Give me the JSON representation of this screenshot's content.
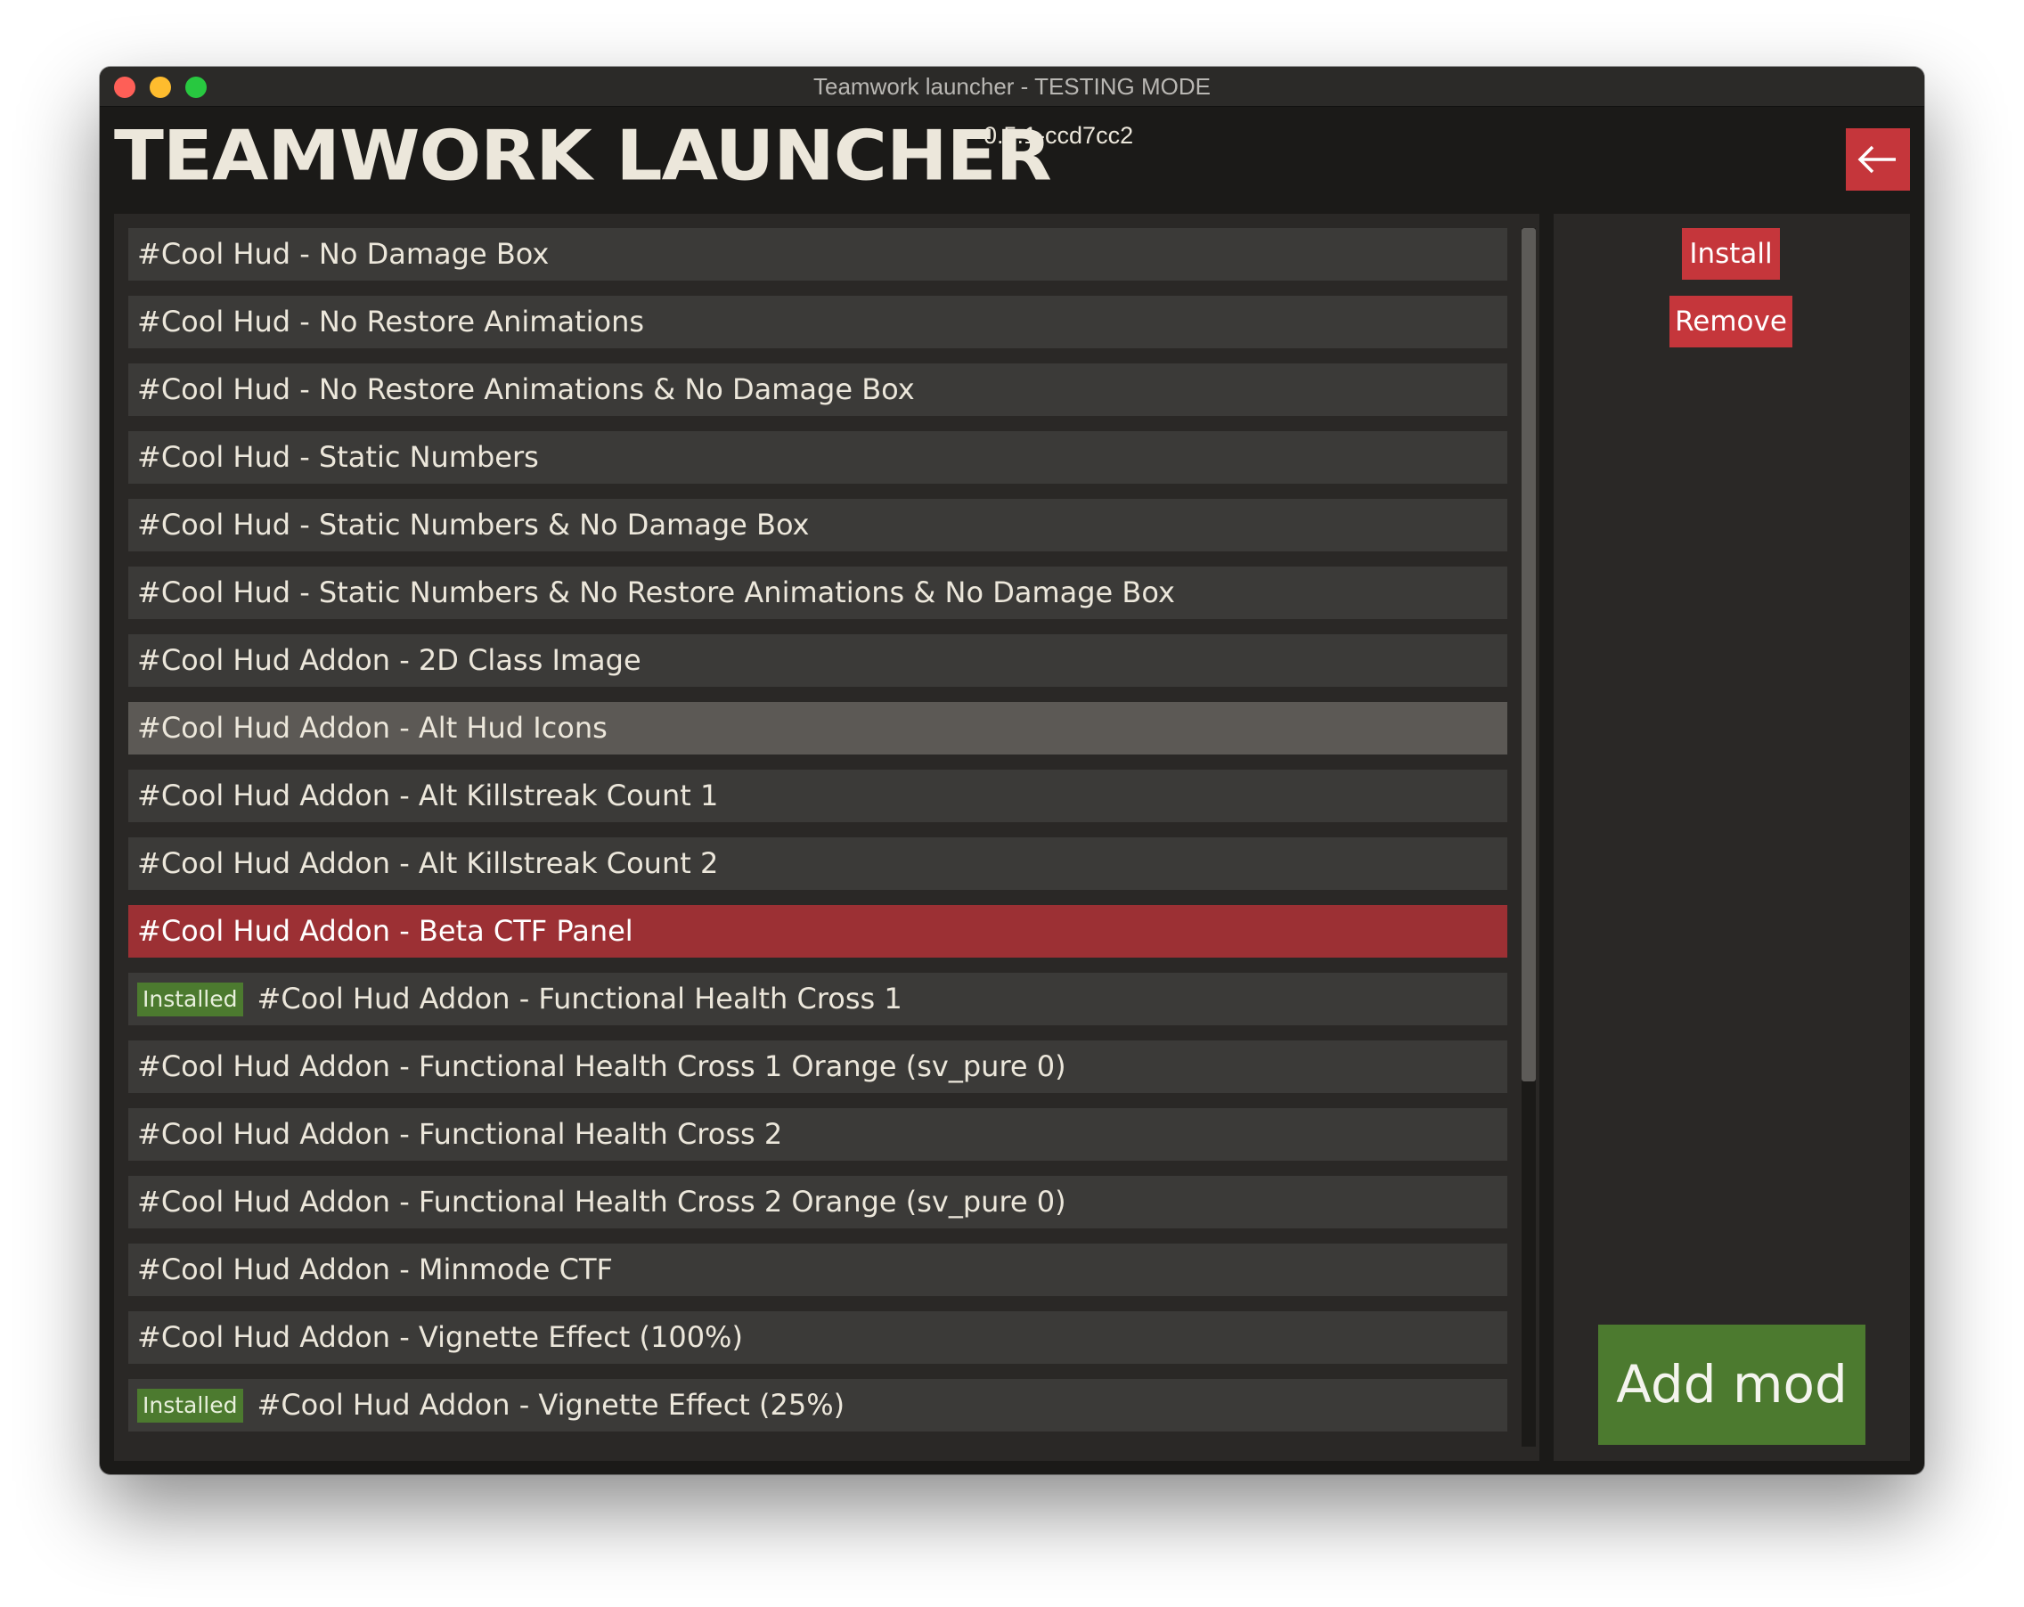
{
  "window": {
    "title": "Teamwork launcher - TESTING MODE"
  },
  "header": {
    "logo": "TEAMWORK LAUNCHER",
    "version": "0.5.1-ccd7cc2",
    "back_icon": "back-arrow-icon"
  },
  "mods": [
    {
      "name": "#Cool Hud - No Damage Box",
      "installed": false,
      "state": "normal"
    },
    {
      "name": "#Cool Hud - No Restore Animations",
      "installed": false,
      "state": "normal"
    },
    {
      "name": "#Cool Hud - No Restore Animations & No Damage Box",
      "installed": false,
      "state": "normal"
    },
    {
      "name": "#Cool Hud - Static Numbers",
      "installed": false,
      "state": "normal"
    },
    {
      "name": "#Cool Hud - Static Numbers & No Damage Box",
      "installed": false,
      "state": "normal"
    },
    {
      "name": "#Cool Hud - Static Numbers & No Restore Animations & No Damage Box",
      "installed": false,
      "state": "normal"
    },
    {
      "name": "#Cool Hud Addon - 2D Class Image",
      "installed": false,
      "state": "normal"
    },
    {
      "name": "#Cool Hud Addon - Alt Hud Icons",
      "installed": false,
      "state": "hovered"
    },
    {
      "name": "#Cool Hud Addon - Alt Killstreak Count 1",
      "installed": false,
      "state": "normal"
    },
    {
      "name": "#Cool Hud Addon - Alt Killstreak Count 2",
      "installed": false,
      "state": "normal"
    },
    {
      "name": "#Cool Hud Addon - Beta CTF Panel",
      "installed": false,
      "state": "selected"
    },
    {
      "name": "#Cool Hud Addon - Functional Health Cross 1",
      "installed": true,
      "state": "normal"
    },
    {
      "name": "#Cool Hud Addon - Functional Health Cross 1 Orange (sv_pure 0)",
      "installed": false,
      "state": "normal"
    },
    {
      "name": "#Cool Hud Addon - Functional Health Cross 2",
      "installed": false,
      "state": "normal"
    },
    {
      "name": "#Cool Hud Addon - Functional Health Cross 2 Orange (sv_pure 0)",
      "installed": false,
      "state": "normal"
    },
    {
      "name": "#Cool Hud Addon - Minmode CTF",
      "installed": false,
      "state": "normal"
    },
    {
      "name": "#Cool Hud Addon - Vignette Effect (100%)",
      "installed": false,
      "state": "normal"
    },
    {
      "name": "#Cool Hud Addon - Vignette Effect (25%)",
      "installed": true,
      "state": "normal"
    }
  ],
  "installed_badge": "Installed",
  "actions": {
    "install": "Install",
    "remove": "Remove",
    "add_mod": "Add mod"
  },
  "colors": {
    "accent_red": "#c5363b",
    "selected_row": "#9c3034",
    "installed_green": "#4c7a2f",
    "background": "#1b1a18"
  },
  "scroll": {
    "visible_fraction": 0.7
  }
}
